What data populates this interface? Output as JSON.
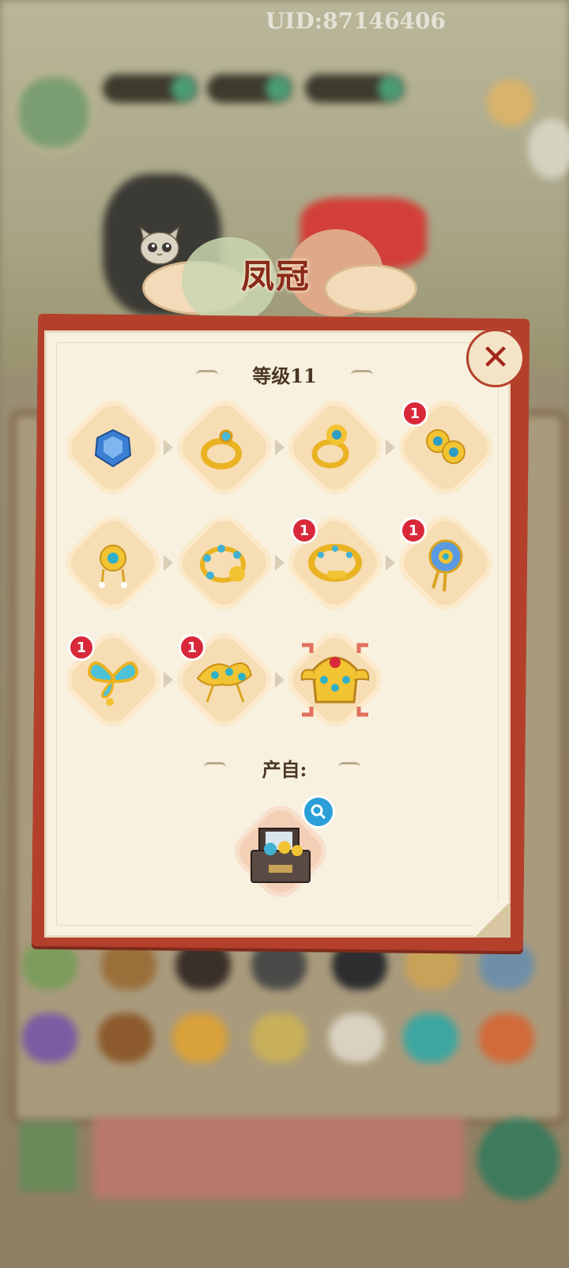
{
  "header": {
    "uid": "UID:87146406"
  },
  "dialog": {
    "title": "凤冠",
    "level_label": "等级11",
    "source_label": "产自:",
    "close_label": "✕"
  },
  "items": [
    {
      "name": "gem",
      "badge": ""
    },
    {
      "name": "gold-ring",
      "badge": ""
    },
    {
      "name": "flower-ring",
      "badge": ""
    },
    {
      "name": "flower-earrings",
      "badge": "1"
    },
    {
      "name": "dangle-earrings",
      "badge": ""
    },
    {
      "name": "beaded-bracelet",
      "badge": ""
    },
    {
      "name": "bangle",
      "badge": "1"
    },
    {
      "name": "flower-hairpin",
      "badge": "1"
    },
    {
      "name": "butterfly-hairpin",
      "badge": "1"
    },
    {
      "name": "ornate-hairpin",
      "badge": "1"
    },
    {
      "name": "phoenix-crown",
      "badge": ""
    }
  ],
  "source": {
    "name": "jewelry-box"
  },
  "colors": {
    "panel_border": "#b4402c",
    "panel_bg": "#f8f1e0",
    "badge": "#d8283a",
    "title": "#8a2a18"
  }
}
